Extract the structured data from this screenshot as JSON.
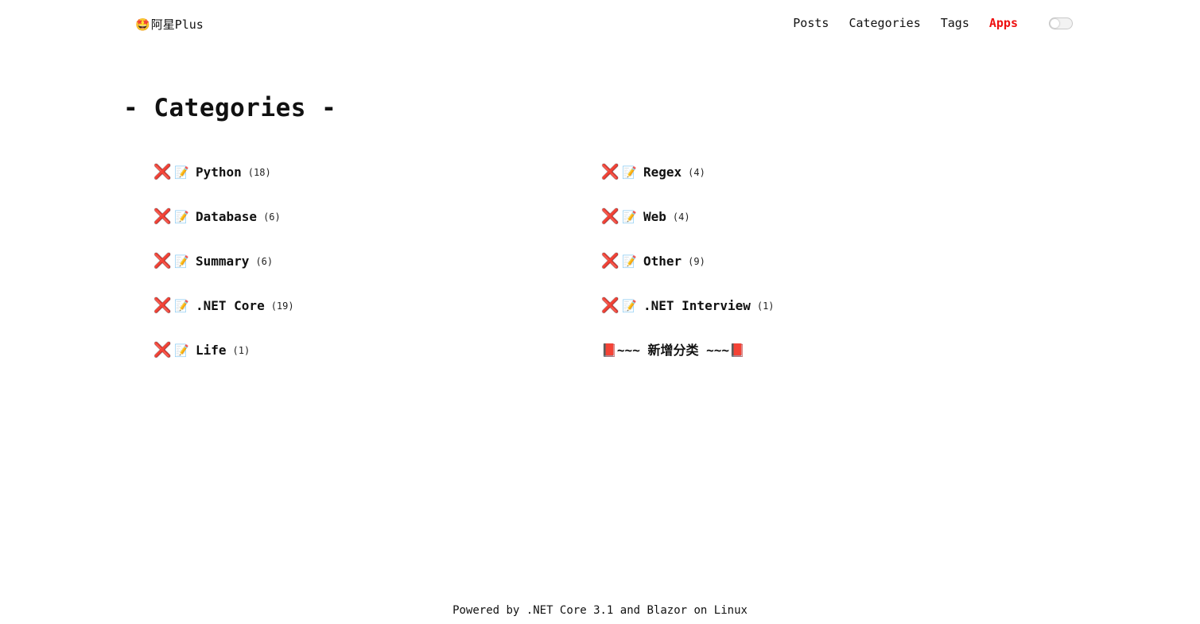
{
  "header": {
    "brand_emoji": "🤩",
    "brand_text": "阿星Plus",
    "nav": {
      "posts": "Posts",
      "categories": "Categories",
      "tags": "Tags",
      "apps": "Apps"
    },
    "theme_toggle": "off"
  },
  "page": {
    "title": "- Categories -"
  },
  "categories": {
    "left": [
      {
        "name": "Python",
        "count": "(18)"
      },
      {
        "name": "Database",
        "count": "(6)"
      },
      {
        "name": "Summary",
        "count": "(6)"
      },
      {
        "name": ".NET Core",
        "count": "(19)"
      },
      {
        "name": "Life",
        "count": "(1)"
      }
    ],
    "right": [
      {
        "name": "Regex",
        "count": "(4)"
      },
      {
        "name": "Web",
        "count": "(4)"
      },
      {
        "name": "Other",
        "count": "(9)"
      },
      {
        "name": ".NET Interview",
        "count": "(1)"
      }
    ],
    "delete_icon": "❌",
    "memo_icon": "📝",
    "add_label": "📕~~~ 新增分类 ~~~📕"
  },
  "footer": {
    "text": "Powered by .NET Core 3.1 and Blazor on Linux"
  },
  "colors": {
    "active_nav": "#ee1111",
    "text": "#111111",
    "background": "#ffffff"
  }
}
